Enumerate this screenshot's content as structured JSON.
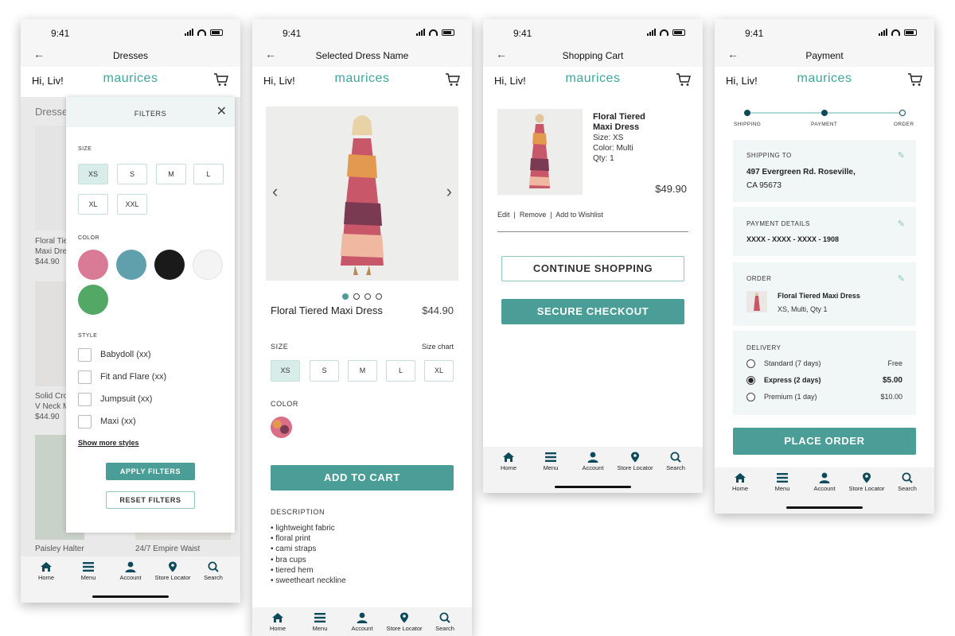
{
  "status": {
    "time": "9:41"
  },
  "brand": {
    "greeting": "Hi, Liv!",
    "logo": "maurices"
  },
  "tabs": {
    "home": "Home",
    "menu": "Menu",
    "account": "Account",
    "store": "Store Locator",
    "search": "Search"
  },
  "screen1": {
    "title": "Dresses",
    "bg": {
      "heading": "Dresses",
      "item1_name": "Floral Tie",
      "item1_name2": "Maxi Dre",
      "item1_price": "$44.90",
      "item2_name": "Solid Cro",
      "item2_name2": "V Neck M",
      "item2_price": "$44.90",
      "item3_name": "Paisley Halter",
      "item4_name": "24/7 Empire Waist"
    },
    "filters": {
      "title": "FILTERS",
      "size_label": "SIZE",
      "sizes": [
        "XS",
        "S",
        "M",
        "L",
        "XL",
        "XXL"
      ],
      "color_label": "COLOR",
      "style_label": "STYLE",
      "styles": [
        "Babydoll (xx)",
        "Fit and Flare (xx)",
        "Jumpsuit (xx)",
        "Maxi (xx)"
      ],
      "show_more": "Show more styles",
      "apply": "APPLY FILTERS",
      "reset": "RESET FILTERS"
    }
  },
  "screen2": {
    "title": "Selected Dress Name",
    "product_name": "Floral Tiered Maxi Dress",
    "price": "$44.90",
    "size_label": "SIZE",
    "size_chart": "Size chart",
    "sizes": [
      "XS",
      "S",
      "M",
      "L",
      "XL"
    ],
    "color_label": "COLOR",
    "add_to_cart": "ADD TO CART",
    "description_label": "DESCRIPTION",
    "bullets": [
      "• lightweight fabric",
      "• floral print",
      "• cami straps",
      "• bra cups",
      "• tiered hem",
      "• sweetheart neckline"
    ]
  },
  "screen3": {
    "title": "Shopping Cart",
    "item_name1": "Floral Tiered",
    "item_name2": "Maxi Dress",
    "item_size": "Size: XS",
    "item_color": "Color: Multi",
    "item_qty": "Qty: 1",
    "item_price": "$49.90",
    "actions": "Edit  |  Remove  |  Add to Wishlist",
    "continue": "CONTINUE SHOPPING",
    "checkout": "SECURE CHECKOUT"
  },
  "screen4": {
    "title": "Payment",
    "steps": [
      "SHIPPING",
      "PAYMENT",
      "ORDER"
    ],
    "shipping_label": "SHIPPING TO",
    "shipping_line1": "497 Evergreen Rd. Roseville,",
    "shipping_line2": "CA 95673",
    "payment_label": "PAYMENT DETAILS",
    "card": "XXXX - XXXX - XXXX - 1908",
    "order_label": "ORDER",
    "order_item": "Floral Tiered Maxi Dress",
    "order_detail": "XS, Multi, Qty 1",
    "delivery_label": "DELIVERY",
    "delivery": [
      {
        "name": "Standard (7 days)",
        "price": "Free"
      },
      {
        "name": "Express (2 days)",
        "price": "$5.00"
      },
      {
        "name": "Premium (1 day)",
        "price": "$10.00"
      }
    ],
    "place_order": "PLACE ORDER"
  },
  "colors": {
    "accent": "#4a9e97",
    "logo": "#3fa69d",
    "swatches": [
      "#d97a97",
      "#5fa0ac",
      "#1a1a1a",
      "#f4f4f4",
      "#54a866"
    ]
  }
}
